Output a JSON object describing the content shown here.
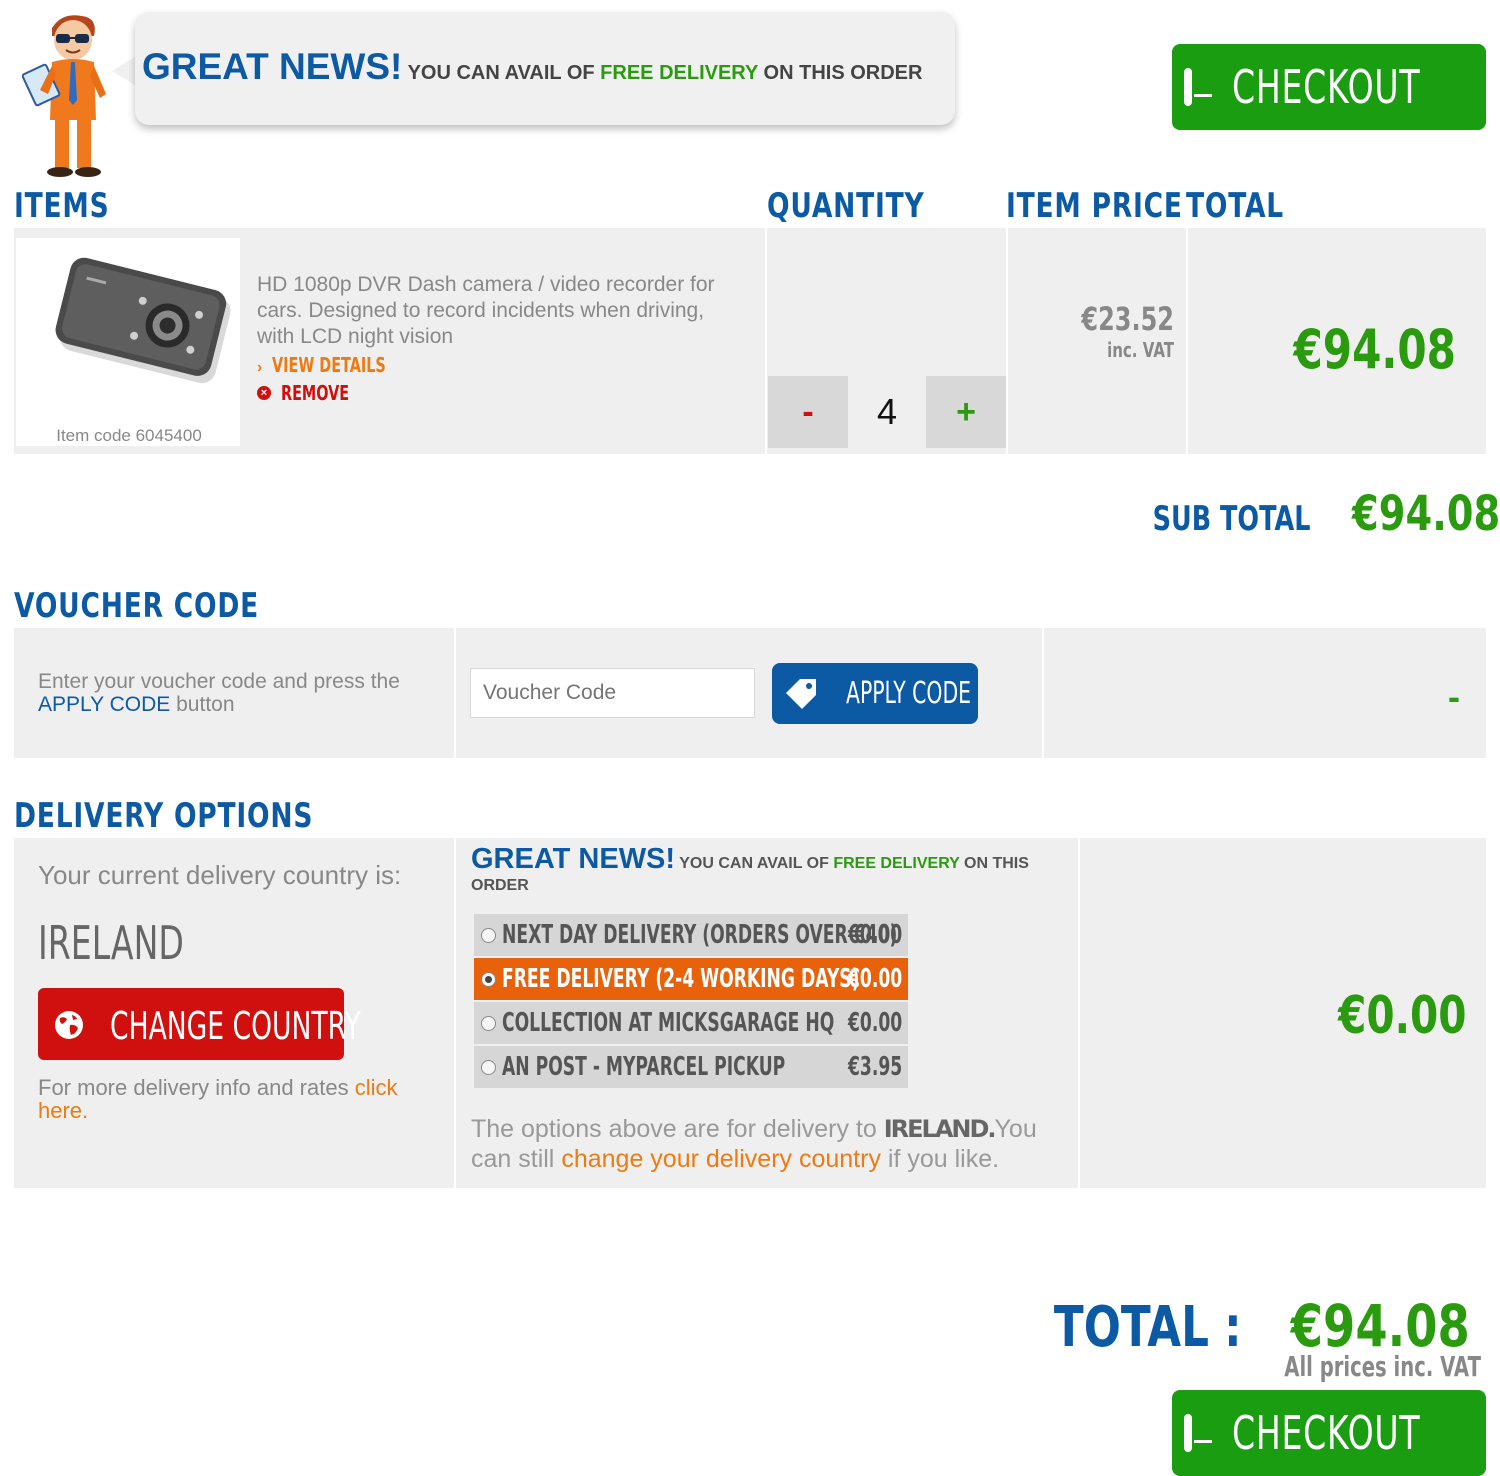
{
  "banner": {
    "headline": "GREAT NEWS!",
    "text_pre": "YOU CAN AVAIL OF",
    "text_free": "FREE DELIVERY",
    "text_post": "ON THIS ORDER"
  },
  "checkout_label": "CHECKOUT",
  "table_headers": {
    "items": "ITEMS",
    "quantity": "QUANTITY",
    "item_price": "ITEM PRICE",
    "total": "TOTAL"
  },
  "item": {
    "description": "HD 1080p DVR Dash camera / video recorder for cars. Designed to record incidents when driving, with LCD night vision",
    "view_details": "VIEW DETAILS",
    "remove": "REMOVE",
    "item_code": "Item code 6045400",
    "quantity": "4",
    "minus": "-",
    "plus": "+",
    "price": "€23.52",
    "price_note": "inc. VAT",
    "total": "€94.08"
  },
  "subtotal": {
    "label": "SUB TOTAL",
    "value": "€94.08"
  },
  "voucher": {
    "heading": "VOUCHER CODE",
    "instruction_pre": "Enter your voucher code and press the",
    "instruction_link": "APPLY CODE",
    "instruction_post": "button",
    "placeholder": "Voucher Code",
    "apply_label": "APPLY CODE",
    "discount": "-"
  },
  "delivery": {
    "heading": "DELIVERY OPTIONS",
    "current_label": "Your current delivery country is:",
    "country": "IRELAND",
    "change_country": "CHANGE COUNTRY",
    "info_pre": "For more delivery info and rates",
    "info_link": "click here.",
    "notice_headline": "GREAT NEWS!",
    "notice_pre": "YOU CAN AVAIL OF",
    "notice_free": "FREE DELIVERY",
    "notice_post": "ON THIS ORDER",
    "options": [
      {
        "label": "NEXT DAY DELIVERY (ORDERS OVER €40)",
        "price": "€0.00",
        "selected": false
      },
      {
        "label": "FREE DELIVERY (2-4 WORKING DAYS)",
        "price": "€0.00",
        "selected": true
      },
      {
        "label": "COLLECTION AT MICKSGARAGE HQ",
        "price": "€0.00",
        "selected": false
      },
      {
        "label": "AN POST - MYPARCEL PICKUP",
        "price": "€3.95",
        "selected": false
      }
    ],
    "footnote_pre": "The options above are for delivery to",
    "footnote_country": "IRELAND.",
    "footnote_mid": "You can still",
    "footnote_link": "change your delivery country",
    "footnote_post": "if you like.",
    "cost": "€0.00"
  },
  "grand_total": {
    "label": "TOTAL :",
    "value": "€94.08",
    "note": "All prices inc. VAT"
  },
  "colors": {
    "brand_blue": "#0b5aa3",
    "price_green": "#2a9b0e",
    "checkout_green": "#1b9d12",
    "selected_orange": "#e8620b",
    "change_country_red": "#d0100e"
  }
}
